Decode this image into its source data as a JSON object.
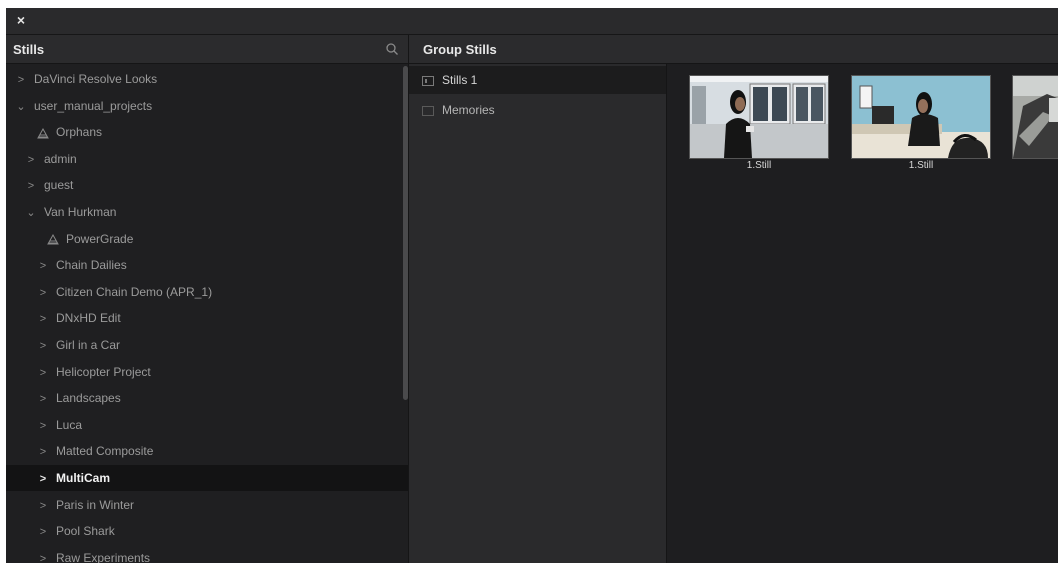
{
  "window": {
    "close_glyph": "×"
  },
  "stills_panel": {
    "title": "Stills"
  },
  "group_panel": {
    "title": "Group Stills"
  },
  "tree": {
    "items": [
      {
        "label": "DaVinci Resolve Looks",
        "chevron": ">",
        "icon": "chevron-right-icon"
      },
      {
        "label": "user_manual_projects",
        "chevron": "⌄",
        "icon": "chevron-down-icon"
      },
      {
        "label": "Orphans",
        "icon": "powergrade-icon"
      },
      {
        "label": "admin",
        "chevron": ">",
        "icon": "chevron-right-icon"
      },
      {
        "label": "guest",
        "chevron": ">",
        "icon": "chevron-right-icon"
      },
      {
        "label": "Van Hurkman",
        "chevron": "⌄",
        "icon": "chevron-down-icon"
      },
      {
        "label": "PowerGrade",
        "icon": "powergrade-icon"
      },
      {
        "label": "Chain Dailies",
        "chevron": ">",
        "icon": "chevron-right-icon"
      },
      {
        "label": "Citizen Chain Demo (APR_1)",
        "chevron": ">",
        "icon": "chevron-right-icon"
      },
      {
        "label": "DNxHD Edit",
        "chevron": ">",
        "icon": "chevron-right-icon"
      },
      {
        "label": "Girl in a Car",
        "chevron": ">",
        "icon": "chevron-right-icon"
      },
      {
        "label": "Helicopter Project",
        "chevron": ">",
        "icon": "chevron-right-icon"
      },
      {
        "label": "Landscapes",
        "chevron": ">",
        "icon": "chevron-right-icon"
      },
      {
        "label": "Luca",
        "chevron": ">",
        "icon": "chevron-right-icon"
      },
      {
        "label": "Matted Composite",
        "chevron": ">",
        "icon": "chevron-right-icon"
      },
      {
        "label": "MultiCam",
        "chevron": ">",
        "icon": "chevron-right-icon",
        "selected": true
      },
      {
        "label": "Paris in Winter",
        "chevron": ">",
        "icon": "chevron-right-icon"
      },
      {
        "label": "Pool Shark",
        "chevron": ">",
        "icon": "chevron-right-icon"
      },
      {
        "label": "Raw Experiments",
        "chevron": ">",
        "icon": "chevron-right-icon"
      }
    ]
  },
  "groups": {
    "items": [
      {
        "label": "Stills 1",
        "active": true
      },
      {
        "label": "Memories",
        "active": false
      }
    ]
  },
  "stills": [
    {
      "label": "1.Still"
    },
    {
      "label": "1.Still"
    },
    {
      "label": ""
    }
  ],
  "colors": {
    "background": "#1f1f21",
    "header": "#2b2b2d",
    "selected_row": "#131314",
    "text": "#9b9b9b"
  }
}
